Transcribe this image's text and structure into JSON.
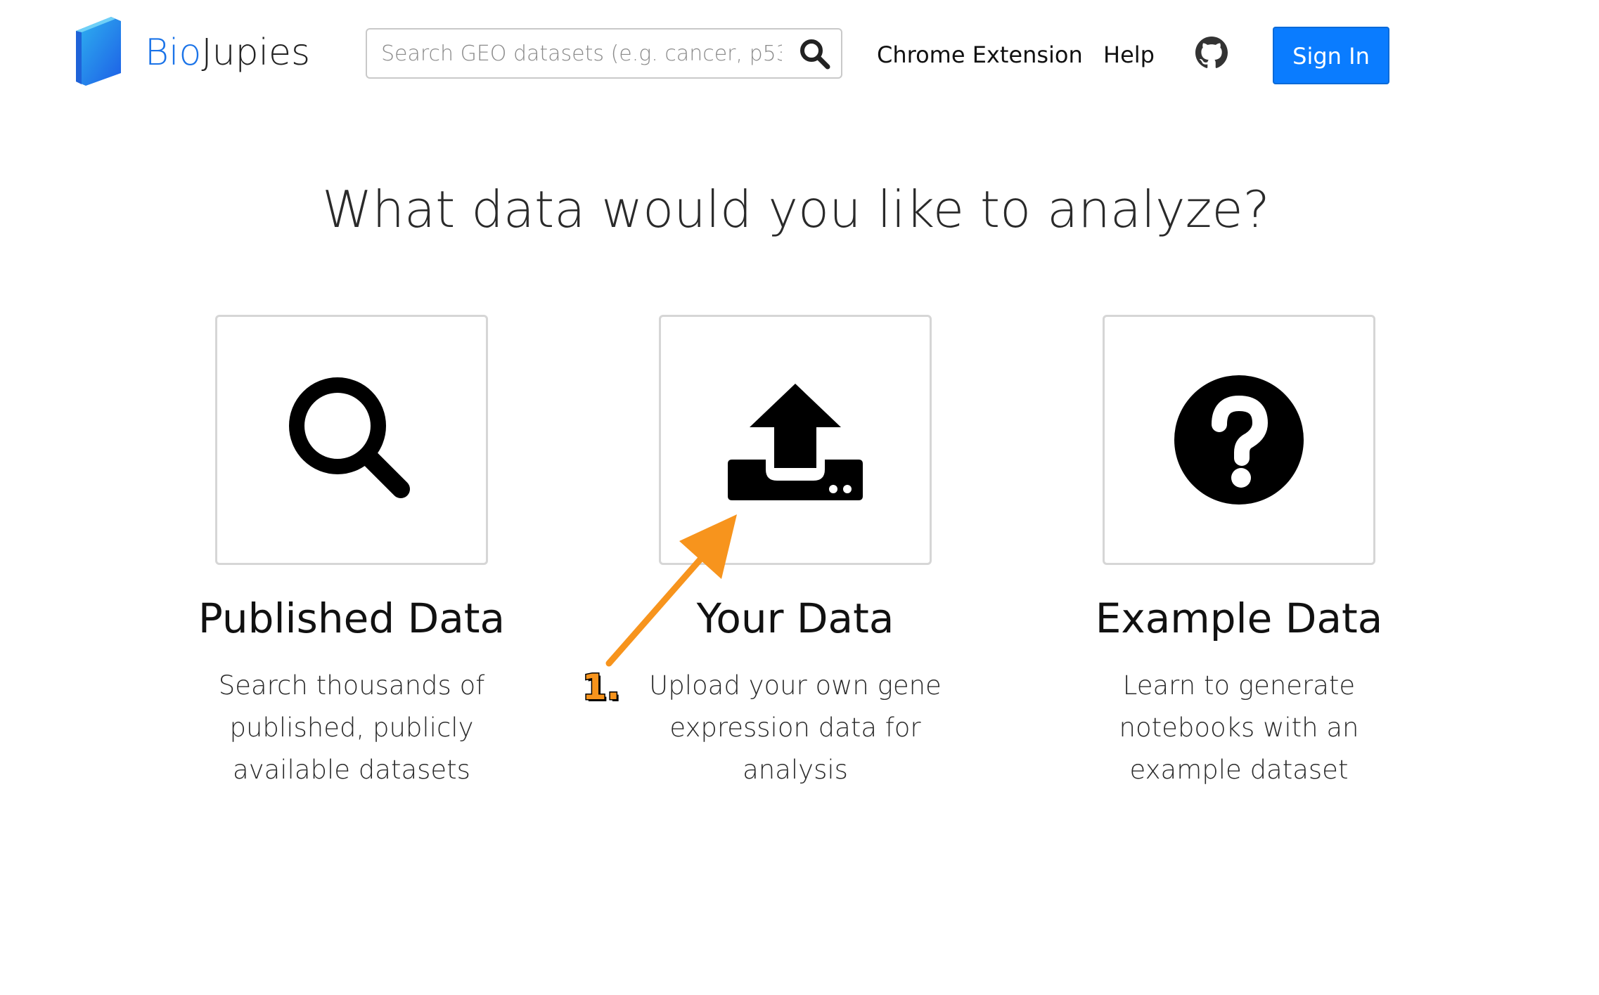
{
  "header": {
    "brand_part1": "Bio",
    "brand_part2": "Jupies",
    "logo_icon": "book-icon",
    "search": {
      "placeholder": "Search GEO datasets (e.g. cancer, p53)",
      "value": "",
      "icon": "search-icon"
    },
    "nav": {
      "chrome_extension": "Chrome Extension",
      "help": "Help",
      "github_icon": "github-icon"
    },
    "sign_in": "Sign In"
  },
  "main": {
    "headline": "What data would you like to analyze?",
    "cards": [
      {
        "icon": "search-icon",
        "title": "Published Data",
        "description": "Search thousands of published, publicly available datasets"
      },
      {
        "icon": "upload-icon",
        "title": "Your Data",
        "description": "Upload your own gene expression data for analysis"
      },
      {
        "icon": "question-circle-icon",
        "title": "Example Data",
        "description": "Learn to generate notebooks with an example dataset"
      }
    ]
  },
  "annotation": {
    "label": "1.",
    "color": "#f7941d"
  },
  "colors": {
    "brand_blue": "#1a73e8",
    "sign_in_bg": "#0a7cff",
    "card_border": "#d6d6d6"
  }
}
